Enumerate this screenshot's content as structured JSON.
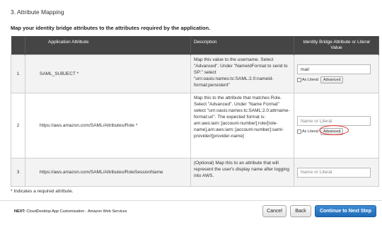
{
  "section": {
    "title": "3. Attribute Mapping",
    "subtitle": "Map your identity bridge attributes to the attributes required by the application."
  },
  "table": {
    "headers": {
      "application_attribute": "Application Attribute",
      "description": "Description",
      "identity_bridge": "Identity Bridge Attribute or Literal Value"
    },
    "rows": [
      {
        "num": "1",
        "attribute": "SAML_SUBJECT *",
        "description": "Map this value to the username. Select \"Advanced\". Under \"NameIdFormat to send to SP:\" select \"urn:oasis:names:tc:SAML:2.0:nameid-format:persistent\"",
        "value": "mail",
        "placeholder": "",
        "show_options": true
      },
      {
        "num": "2",
        "attribute": "https://aws.amazon.com/SAML/Attributes/Role *",
        "description": "Map this to the attribute that matches Role. Select \"Advanced\". Under \"Name Format\" select \"urn:oasis:names:tc:SAML:2.0:attrname-format:uri\". The expected format is: arn:aws:iam::[account-number]:role/[role-name],arn:aws:iam::[account-number]:saml-provider/[provider-name]",
        "value": "",
        "placeholder": "Name or Literal",
        "show_options": true
      },
      {
        "num": "3",
        "attribute": "https://aws.amazon.com/SAML/Attributes/RoleSessionName",
        "description": "(Optional) Map this to an attribute that will represent the user's display name after logging into AWS.",
        "value": "",
        "placeholder": "Name or Literal",
        "show_options": false
      }
    ],
    "as_literal_label": "As Literal",
    "advanced_label": "Advanced"
  },
  "footnote": "* Indicates a required attribute.",
  "footer": {
    "next_prefix": "NEXT:",
    "next_text": "CloudDesktop App Customization - Amazon Web Services",
    "cancel": "Cancel",
    "back": "Back",
    "continue": "Continue to Next Step"
  },
  "colors": {
    "header_bg": "#454545",
    "primary_button": "#2a79c6",
    "highlight_circle": "#e0332a"
  }
}
